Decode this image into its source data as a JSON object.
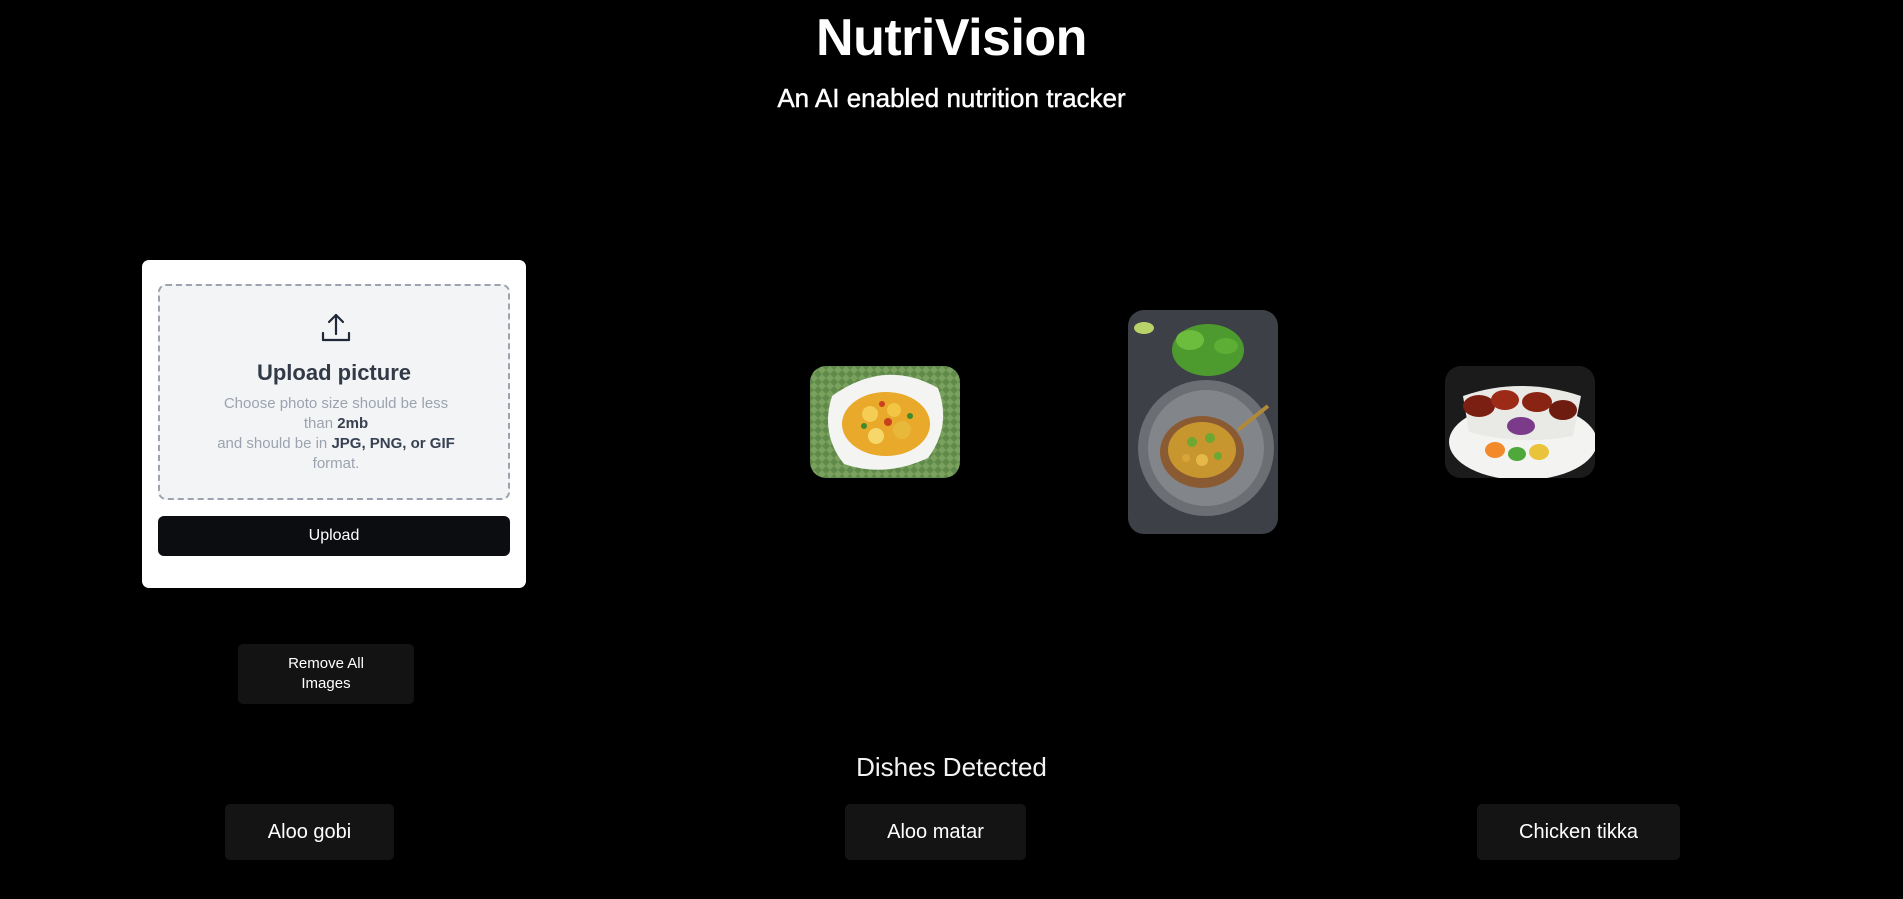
{
  "header": {
    "title": "NutriVision",
    "subtitle": "An AI enabled nutrition tracker"
  },
  "upload": {
    "title": "Upload picture",
    "desc_line1": "Choose photo size should be less than ",
    "size_limit": "2mb",
    "desc_line2": "and should be in ",
    "formats": "JPG, PNG, or GIF",
    "desc_line3": " format.",
    "button_label": "Upload",
    "icon": "upload-icon"
  },
  "actions": {
    "remove_all_label": "Remove All Images"
  },
  "images": [
    {
      "name": "aloo-gobi-photo"
    },
    {
      "name": "aloo-matar-photo"
    },
    {
      "name": "chicken-tikka-photo"
    }
  ],
  "results": {
    "title": "Dishes Detected",
    "dishes": [
      "Aloo gobi",
      "Aloo matar",
      "Chicken tikka"
    ]
  },
  "colors": {
    "background": "#000000",
    "card": "#ffffff",
    "dropzone": "#f3f4f6",
    "button": "#0b0d10",
    "chip": "#141414"
  }
}
